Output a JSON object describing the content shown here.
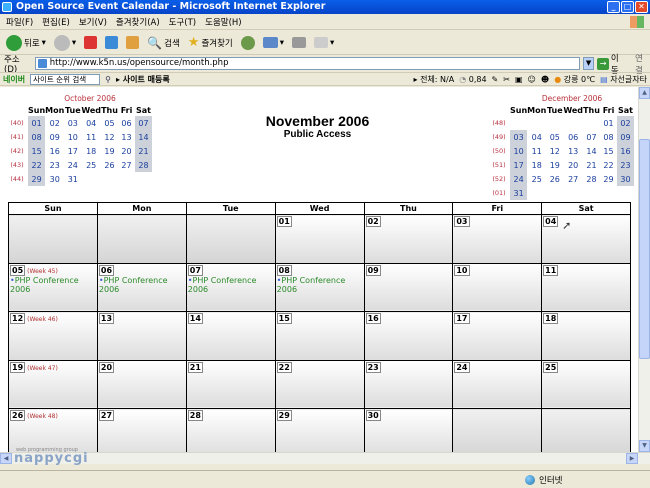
{
  "window": {
    "title": "Open Source Event Calendar - Microsoft Internet Explorer"
  },
  "menu": {
    "items": [
      "파일(F)",
      "편집(E)",
      "보기(V)",
      "즐겨찾기(A)",
      "도구(T)",
      "도움말(H)"
    ]
  },
  "toolbar": {
    "back_label": "뒤로",
    "search_label": "검색",
    "favorites_label": "즐겨찾기"
  },
  "address": {
    "label": "주소(D)",
    "url": "http://www.k5n.us/opensource/month.php",
    "go_label": "이동",
    "links_label": "연결"
  },
  "linkbar": {
    "brand": "네이버",
    "search_placeholder": "사이트 순위 검색",
    "site_link": "사이트 매등록",
    "rank_label": "전체: N/A",
    "score": "0,84",
    "weather": "강릉 0℃",
    "extra": "자선글자타"
  },
  "page": {
    "month_title": "November 2006",
    "subtitle": "Public Access"
  },
  "mini_prev": {
    "title": "October 2006",
    "headers": [
      "Sun",
      "Mon",
      "Tue",
      "Wed",
      "Thu",
      "Fri",
      "Sat"
    ],
    "weeks": [
      {
        "wk": "(40)",
        "days": [
          "01",
          "02",
          "03",
          "04",
          "05",
          "06",
          "07"
        ]
      },
      {
        "wk": "(41)",
        "days": [
          "08",
          "09",
          "10",
          "11",
          "12",
          "13",
          "14"
        ]
      },
      {
        "wk": "(42)",
        "days": [
          "15",
          "16",
          "17",
          "18",
          "19",
          "20",
          "21"
        ]
      },
      {
        "wk": "(43)",
        "days": [
          "22",
          "23",
          "24",
          "25",
          "26",
          "27",
          "28"
        ]
      },
      {
        "wk": "(44)",
        "days": [
          "29",
          "30",
          "31",
          "",
          "",
          "",
          ""
        ]
      }
    ]
  },
  "mini_next": {
    "title": "December 2006",
    "headers": [
      "Sun",
      "Mon",
      "Tue",
      "Wed",
      "Thu",
      "Fri",
      "Sat"
    ],
    "weeks": [
      {
        "wk": "(48)",
        "days": [
          "",
          "",
          "",
          "",
          "",
          "01",
          "02"
        ]
      },
      {
        "wk": "(49)",
        "days": [
          "03",
          "04",
          "05",
          "06",
          "07",
          "08",
          "09"
        ]
      },
      {
        "wk": "(50)",
        "days": [
          "10",
          "11",
          "12",
          "13",
          "14",
          "15",
          "16"
        ]
      },
      {
        "wk": "(51)",
        "days": [
          "17",
          "18",
          "19",
          "20",
          "21",
          "22",
          "23"
        ]
      },
      {
        "wk": "(52)",
        "days": [
          "24",
          "25",
          "26",
          "27",
          "28",
          "29",
          "30"
        ]
      },
      {
        "wk": "(01)",
        "days": [
          "31",
          "",
          "",
          "",
          "",
          "",
          ""
        ]
      }
    ]
  },
  "calendar": {
    "headers": [
      "Sun",
      "Mon",
      "Tue",
      "Wed",
      "Thu",
      "Fri",
      "Sat"
    ],
    "weeks": [
      {
        "label": "",
        "days": [
          "",
          "",
          "",
          "01",
          "02",
          "03",
          "04"
        ]
      },
      {
        "label": "(Week 45)",
        "days": [
          "05",
          "06",
          "07",
          "08",
          "09",
          "10",
          "11"
        ]
      },
      {
        "label": "(Week 46)",
        "days": [
          "12",
          "13",
          "14",
          "15",
          "16",
          "17",
          "18"
        ]
      },
      {
        "label": "(Week 47)",
        "days": [
          "19",
          "20",
          "21",
          "22",
          "23",
          "24",
          "25"
        ]
      },
      {
        "label": "(Week 48)",
        "days": [
          "26",
          "27",
          "28",
          "29",
          "30",
          "",
          ""
        ]
      }
    ],
    "events": {
      "05": "PHP Conference 2006",
      "06": "PHP Conference 2006",
      "07": "PHP Conference 2006",
      "08": "PHP Conference 2006"
    }
  },
  "footer": {
    "logo_tag": "web programming group",
    "logo": "nappycgi"
  },
  "status": {
    "zone": "인터넷"
  }
}
